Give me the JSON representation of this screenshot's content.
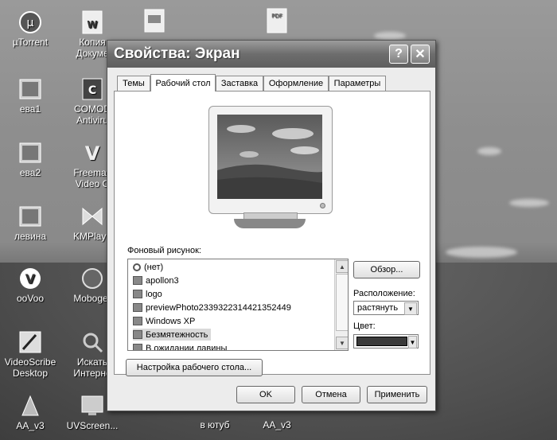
{
  "desktop": {
    "icons": [
      {
        "label": "µTorrent"
      },
      {
        "label": "Копия\nДокуме"
      },
      {
        "label": "ева1"
      },
      {
        "label": "COMOD\nAntiviru"
      },
      {
        "label": "ева2"
      },
      {
        "label": "Freemak\nVideo C"
      },
      {
        "label": "левина"
      },
      {
        "label": "KMPlaye"
      },
      {
        "label": "ooVoo"
      },
      {
        "label": "Moboger"
      },
      {
        "label": "VideoScribe\nDesktop"
      },
      {
        "label": "Искать\nИнтерне"
      },
      {
        "label": "AA_v3"
      },
      {
        "label": "UVScreen..."
      },
      {
        "label": "в ютуб"
      },
      {
        "label": "AA_v3"
      }
    ]
  },
  "dialog": {
    "title": "Свойства: Экран",
    "help_glyph": "?",
    "close_glyph": "✕",
    "tabs": [
      {
        "label": "Темы"
      },
      {
        "label": "Рабочий стол"
      },
      {
        "label": "Заставка"
      },
      {
        "label": "Оформление"
      },
      {
        "label": "Параметры"
      }
    ],
    "active_tab": "Рабочий стол",
    "background_label": "Фоновый рисунок:",
    "backgrounds": [
      {
        "label": "(нет)",
        "icon": "none-icon"
      },
      {
        "label": "apollon3",
        "icon": "image-icon"
      },
      {
        "label": "logo",
        "icon": "image-icon"
      },
      {
        "label": "previewPhoto2339322314421352449",
        "icon": "image-icon"
      },
      {
        "label": "Windows XP",
        "icon": "image-icon"
      },
      {
        "label": "Безмятежность",
        "icon": "image-icon"
      },
      {
        "label": "В ожидании лавины",
        "icon": "image-icon"
      }
    ],
    "selected_background": "Безмятежность",
    "browse_button": "Обзор...",
    "position_label": "Расположение:",
    "position_value": "растянуть",
    "color_label": "Цвет:",
    "color_value": "#3a3a3a",
    "customize_button": "Настройка рабочего стола...",
    "ok_button": "OK",
    "cancel_button": "Отмена",
    "apply_button": "Применить"
  }
}
